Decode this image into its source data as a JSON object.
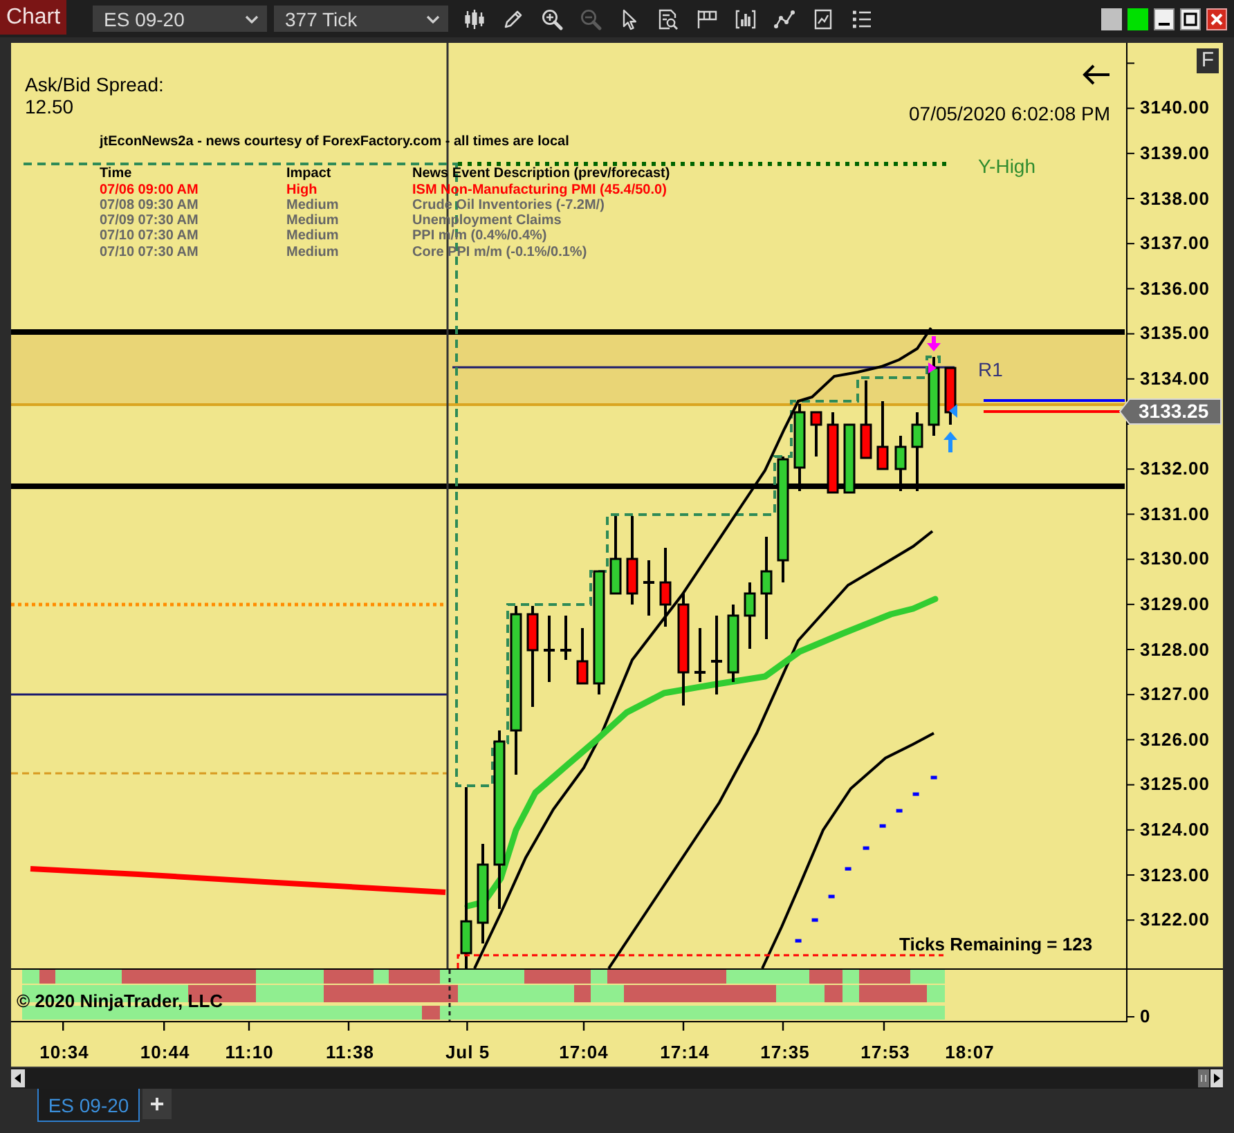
{
  "toolbar": {
    "title": "Chart",
    "instrument": "ES 09-20",
    "interval": "377 Tick",
    "tools": [
      {
        "kind": "candles",
        "disabled": false
      },
      {
        "kind": "pencil",
        "disabled": false
      },
      {
        "kind": "zoom_in",
        "disabled": false
      },
      {
        "kind": "zoom_out",
        "disabled": true
      },
      {
        "kind": "pointer",
        "disabled": false
      },
      {
        "kind": "data_box",
        "disabled": false
      },
      {
        "kind": "flag",
        "disabled": false
      },
      {
        "kind": "bars",
        "disabled": false
      },
      {
        "kind": "line",
        "disabled": false
      },
      {
        "kind": "document",
        "disabled": false
      },
      {
        "kind": "list",
        "disabled": false
      }
    ],
    "link_buttons": [
      {
        "color": "#c0c0c0"
      },
      {
        "color": "#00e000"
      }
    ]
  },
  "chart": {
    "corner_button": "F",
    "spread": {
      "label": "Ask/Bid Spread:",
      "value": "12.50"
    },
    "timestamp": "07/05/2020 6:02:08 PM",
    "news": {
      "title": "jtEconNews2a - news courtesy of ForexFactory.com - all times are local",
      "columns": [
        "Time",
        "Impact",
        "News Event Description (prev/forecast)"
      ],
      "rows": [
        {
          "time": "07/06 09:00 AM",
          "impact": "High",
          "event": "ISM Non-Manufacturing PMI (45.4/50.0)",
          "color": "#ff0000"
        },
        {
          "time": "07/08 09:30 AM",
          "impact": "Medium",
          "event": "Crude Oil Inventories (-7.2M/)",
          "color": "#666666"
        },
        {
          "time": "07/09 07:30 AM",
          "impact": "Medium",
          "event": "Unemployment Claims",
          "color": "#666666"
        },
        {
          "time": "07/10 07:30 AM",
          "impact": "Medium",
          "event": "PPI m/m (0.4%/0.4%)",
          "color": "#666666"
        },
        {
          "time": "07/10 07:30 AM",
          "impact": "Medium",
          "event": "Core PPI m/m (-0.1%/0.1%)",
          "color": "#666666"
        }
      ]
    },
    "level_labels": [
      {
        "kind": "y_high",
        "text": "Y-High"
      },
      {
        "kind": "r1",
        "text": "R1"
      }
    ],
    "ticks_remaining": "Ticks Remaining = 123",
    "copyright": "© 2020 NinjaTrader, LLC"
  },
  "price_axis": {
    "labels": [
      "3140.00",
      "3139.00",
      "3138.00",
      "3137.00",
      "3136.00",
      "3135.00",
      "3134.00",
      "3132.00",
      "3131.00",
      "3130.00",
      "3129.00",
      "3128.00",
      "3127.00",
      "3126.00",
      "3125.00",
      "3124.00",
      "3123.00",
      "3122.00"
    ],
    "last_price": "3133.25",
    "indicator_labels": [
      "0"
    ]
  },
  "time_axis": {
    "labels": [
      "10:34",
      "10:44",
      "11:10",
      "11:38",
      "Jul 5",
      "17:04",
      "17:14",
      "17:35",
      "17:53",
      "18:07"
    ]
  },
  "tabs": [
    {
      "label": "ES 09-20",
      "selected": true
    }
  ],
  "add_tab": "+"
}
